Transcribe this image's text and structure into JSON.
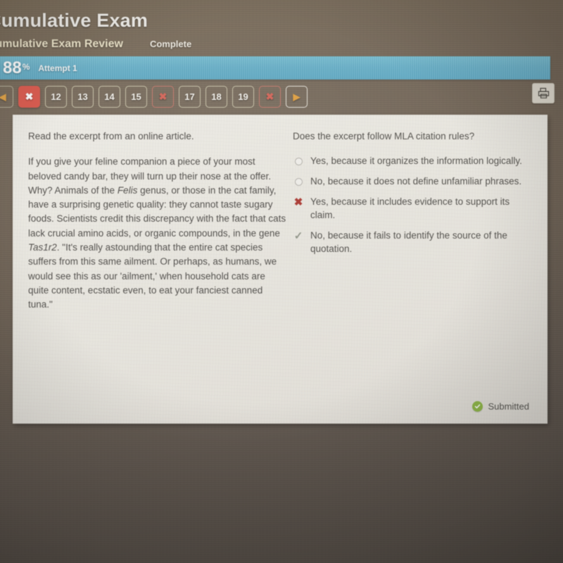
{
  "header": {
    "title": "Cumulative Exam",
    "breadcrumb": "Cumulative Exam Review",
    "status": "Complete"
  },
  "score_bar": {
    "score": "88",
    "percent_symbol": "%",
    "attempt": "Attempt 1",
    "color": "#63b6d6"
  },
  "nav": {
    "prev_icon": "◀",
    "next_icon": "▶",
    "items": [
      {
        "label": "✖",
        "state": "wrong-current",
        "name": "nav-question-11"
      },
      {
        "label": "12",
        "state": "normal",
        "name": "nav-question-12"
      },
      {
        "label": "13",
        "state": "normal",
        "name": "nav-question-13"
      },
      {
        "label": "14",
        "state": "normal",
        "name": "nav-question-14"
      },
      {
        "label": "15",
        "state": "normal",
        "name": "nav-question-15"
      },
      {
        "label": "✖",
        "state": "wrong",
        "name": "nav-question-16"
      },
      {
        "label": "17",
        "state": "normal",
        "name": "nav-question-17"
      },
      {
        "label": "18",
        "state": "normal",
        "name": "nav-question-18"
      },
      {
        "label": "19",
        "state": "normal",
        "name": "nav-question-19"
      },
      {
        "label": "✖",
        "state": "wrong",
        "name": "nav-question-20"
      }
    ]
  },
  "toolbar": {
    "print_icon": "print-icon"
  },
  "content": {
    "prompt": "Read the excerpt from an online article.",
    "excerpt_part1": "If you give your feline companion a piece of your most beloved candy bar, they will turn up their nose at the offer. Why? Animals of the ",
    "excerpt_italic1": "Felis",
    "excerpt_part2": " genus, or those in the cat family, have a surprising genetic quality: they cannot taste sugary foods. Scientists credit this discrepancy with the fact that cats lack crucial amino acids, or organic compounds, in the gene ",
    "excerpt_italic2": "Tas1r2",
    "excerpt_part3": ". \"It's really astounding that the entire cat species suffers from this same ailment. Or perhaps, as humans, we would see this as our 'ailment,' when household cats are quite content, ecstatic even, to eat your fanciest canned tuna.\""
  },
  "question": {
    "text": "Does the excerpt follow MLA citation rules?",
    "options": [
      {
        "text": "Yes, because it organizes the information logically.",
        "mark": "radio"
      },
      {
        "text": "No, because it does not define unfamiliar phrases.",
        "mark": "radio"
      },
      {
        "text": "Yes, because it includes evidence to support its claim.",
        "mark": "x"
      },
      {
        "text": "No, because it fails to identify the source of the quotation.",
        "mark": "check"
      }
    ]
  },
  "footer": {
    "submitted_label": "Submitted",
    "submitted_color": "#8cb93c"
  }
}
